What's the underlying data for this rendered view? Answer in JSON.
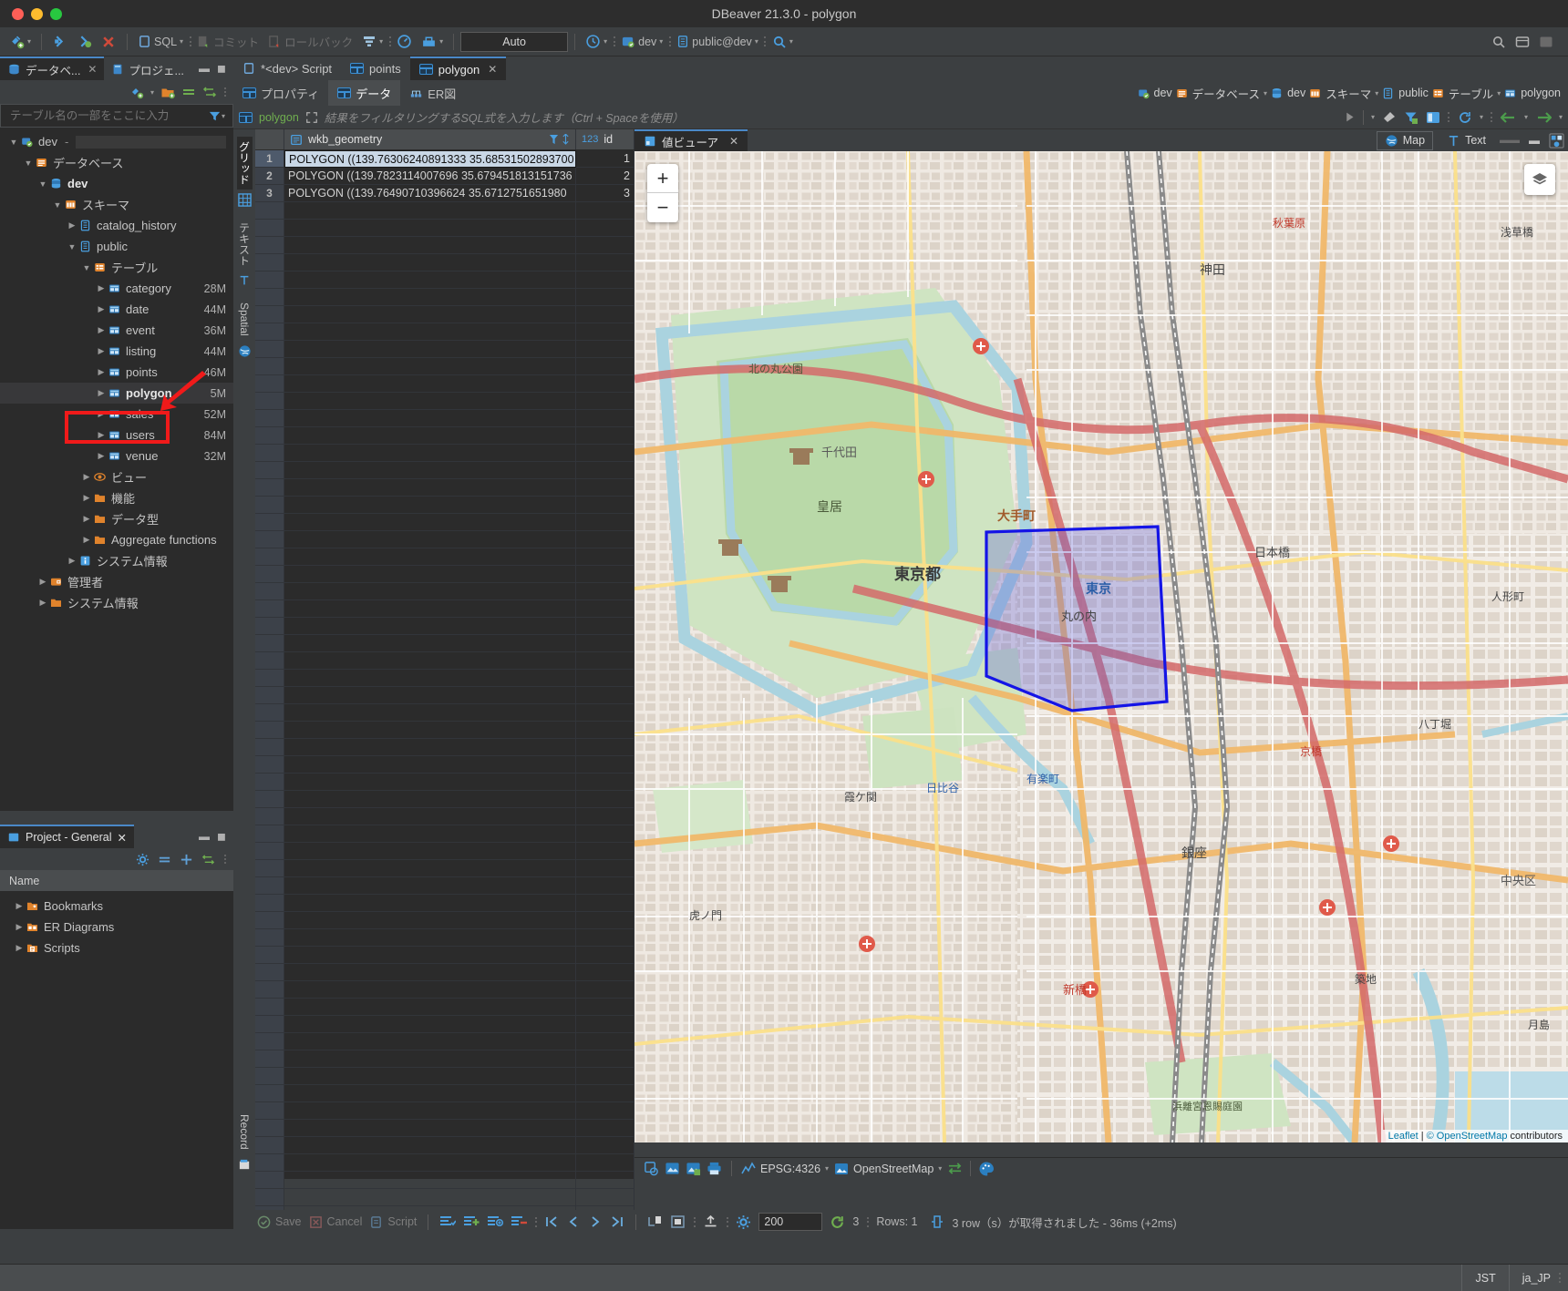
{
  "window": {
    "title": "DBeaver 21.3.0 - polygon"
  },
  "toolbar": {
    "items": [
      {
        "icon": "new-connection-icon",
        "label": ""
      },
      {
        "icon": "connect-icon",
        "label": ""
      },
      {
        "icon": "refresh-connection-icon",
        "label": ""
      },
      {
        "icon": "disconnect-icon",
        "label": ""
      },
      {
        "icon": "sql-editor-icon",
        "label": "SQL"
      },
      {
        "icon": "commit-icon",
        "label": "コミット"
      },
      {
        "icon": "rollback-icon",
        "label": "ロールバック"
      },
      {
        "icon": "transaction-mode-icon",
        "label": ""
      },
      {
        "icon": "dashboard-icon",
        "label": ""
      },
      {
        "icon": "db-tools-icon",
        "label": ""
      }
    ],
    "auto_commit_value": "Auto",
    "history_icon": "history-icon",
    "connection_label": "dev",
    "schema_label": "public@dev",
    "search_icon": "search-icon"
  },
  "left": {
    "tabs": [
      {
        "label": "データベ...",
        "active": true,
        "closable": true
      },
      {
        "label": "プロジェ...",
        "active": false,
        "closable": false
      }
    ],
    "minimize_icon": "minimize-icon",
    "maximize_icon": "maximize-icon",
    "filter_placeholder": "テーブル名の一部をここに入力",
    "filter_icon": "filter-icon",
    "tree": [
      {
        "indent": 0,
        "twist": "v",
        "icon": "connection-icon",
        "label": "dev",
        "suffix": "-",
        "size": "",
        "bold": false,
        "selected": false
      },
      {
        "indent": 1,
        "twist": "v",
        "icon": "database-folder-icon",
        "label": "データベース",
        "size": "",
        "bold": false,
        "selected": false
      },
      {
        "indent": 2,
        "twist": "v",
        "icon": "database-icon",
        "label": "dev",
        "size": "",
        "bold": true,
        "selected": false
      },
      {
        "indent": 3,
        "twist": "v",
        "icon": "schemas-icon",
        "label": "スキーマ",
        "size": "",
        "bold": false,
        "selected": false
      },
      {
        "indent": 4,
        "twist": ">",
        "icon": "schema-icon",
        "label": "catalog_history",
        "size": "",
        "bold": false,
        "selected": false
      },
      {
        "indent": 4,
        "twist": "v",
        "icon": "schema-icon",
        "label": "public",
        "size": "",
        "bold": false,
        "selected": false
      },
      {
        "indent": 5,
        "twist": "v",
        "icon": "tables-folder-icon",
        "label": "テーブル",
        "size": "",
        "bold": false,
        "selected": false
      },
      {
        "indent": 6,
        "twist": ">",
        "icon": "table-icon",
        "label": "category",
        "size": "28M",
        "bold": false,
        "selected": false
      },
      {
        "indent": 6,
        "twist": ">",
        "icon": "table-icon",
        "label": "date",
        "size": "44M",
        "bold": false,
        "selected": false
      },
      {
        "indent": 6,
        "twist": ">",
        "icon": "table-icon",
        "label": "event",
        "size": "36M",
        "bold": false,
        "selected": false
      },
      {
        "indent": 6,
        "twist": ">",
        "icon": "table-icon",
        "label": "listing",
        "size": "44M",
        "bold": false,
        "selected": false
      },
      {
        "indent": 6,
        "twist": ">",
        "icon": "table-icon",
        "label": "points",
        "size": "46M",
        "bold": false,
        "selected": false
      },
      {
        "indent": 6,
        "twist": ">",
        "icon": "table-icon",
        "label": "polygon",
        "size": "5M",
        "bold": true,
        "selected": true
      },
      {
        "indent": 6,
        "twist": ">",
        "icon": "table-icon",
        "label": "sales",
        "size": "52M",
        "bold": false,
        "selected": false
      },
      {
        "indent": 6,
        "twist": ">",
        "icon": "table-icon",
        "label": "users",
        "size": "84M",
        "bold": false,
        "selected": false
      },
      {
        "indent": 6,
        "twist": ">",
        "icon": "table-icon",
        "label": "venue",
        "size": "32M",
        "bold": false,
        "selected": false
      },
      {
        "indent": 5,
        "twist": ">",
        "icon": "views-icon",
        "label": "ビュー",
        "size": "",
        "bold": false,
        "selected": false
      },
      {
        "indent": 5,
        "twist": ">",
        "icon": "folder-icon",
        "label": "機能",
        "size": "",
        "bold": false,
        "selected": false
      },
      {
        "indent": 5,
        "twist": ">",
        "icon": "folder-icon",
        "label": "データ型",
        "size": "",
        "bold": false,
        "selected": false
      },
      {
        "indent": 5,
        "twist": ">",
        "icon": "folder-icon",
        "label": "Aggregate functions",
        "size": "",
        "bold": false,
        "selected": false
      },
      {
        "indent": 4,
        "twist": ">",
        "icon": "info-icon",
        "label": "システム情報",
        "size": "",
        "bold": false,
        "selected": false
      },
      {
        "indent": 2,
        "twist": ">",
        "icon": "admin-icon",
        "label": "管理者",
        "size": "",
        "bold": false,
        "selected": false
      },
      {
        "indent": 2,
        "twist": ">",
        "icon": "folder-icon",
        "label": "システム情報",
        "size": "",
        "bold": false,
        "selected": false
      }
    ]
  },
  "project": {
    "tab_label": "Project - General",
    "column_header": "Name",
    "items": [
      {
        "icon": "bookmarks-folder-icon",
        "label": "Bookmarks"
      },
      {
        "icon": "er-diagrams-folder-icon",
        "label": "ER Diagrams"
      },
      {
        "icon": "scripts-folder-icon",
        "label": "Scripts"
      }
    ]
  },
  "editor": {
    "tabs": [
      {
        "label": "*<dev> Script",
        "icon": "sql-script-icon",
        "active": false,
        "closable": false
      },
      {
        "label": "points",
        "icon": "table-icon",
        "active": false,
        "closable": false
      },
      {
        "label": "polygon",
        "icon": "table-icon",
        "active": true,
        "closable": true
      }
    ],
    "subtabs": [
      {
        "label": "プロパティ",
        "icon": "properties-icon",
        "active": false
      },
      {
        "label": "データ",
        "icon": "data-icon",
        "active": true
      },
      {
        "label": "ER図",
        "icon": "er-diagram-icon",
        "active": false
      }
    ],
    "breadcrumb": [
      {
        "label": "dev",
        "icon": "connection-icon",
        "caret": false
      },
      {
        "label": "データベース",
        "icon": "database-folder-icon",
        "caret": true
      },
      {
        "label": "dev",
        "icon": "database-icon",
        "caret": false
      },
      {
        "label": "スキーマ",
        "icon": "schemas-icon",
        "caret": true
      },
      {
        "label": "public",
        "icon": "schema-icon",
        "caret": false
      },
      {
        "label": "テーブル",
        "icon": "tables-folder-icon",
        "caret": true
      },
      {
        "label": "polygon",
        "icon": "table-icon",
        "caret": false
      }
    ],
    "filter": {
      "table_chip": "polygon",
      "placeholder": "結果をフィルタリングするSQL式を入力します（Ctrl + Spaceを使用）",
      "execute_icon": "execute-icon",
      "dropdown_icon": "chevron-down-icon",
      "clear_icon": "eraser-icon",
      "save_filter_icon": "filter-save-icon",
      "panels_icon": "panels-icon",
      "refresh_icon": "refresh-icon",
      "back_icon": "arrow-left-icon",
      "forward_icon": "arrow-right-icon"
    }
  },
  "grid": {
    "side_tabs": [
      {
        "label": "グリッド",
        "icon": "grid-icon",
        "active": true
      },
      {
        "label": "テキスト",
        "icon": "text-icon",
        "active": false
      },
      {
        "label": "Spatial",
        "icon": "spatial-icon",
        "active": false
      }
    ],
    "record_tab": {
      "label": "Record",
      "icon": "record-icon"
    },
    "columns": [
      {
        "name": "wkb_geometry",
        "icon": "geometry-column-icon",
        "type_badge": ""
      },
      {
        "name": "id",
        "icon": "",
        "type_badge": "123"
      }
    ],
    "rows": [
      {
        "num": "1",
        "wkb_geometry": "POLYGON ((139.76306240891333 35.68531502893700",
        "id": "1",
        "selected": true
      },
      {
        "num": "2",
        "wkb_geometry": "POLYGON ((139.7823114007696 35.679451813151736",
        "id": "2",
        "selected": false
      },
      {
        "num": "3",
        "wkb_geometry": "POLYGON ((139.76490710396624 35.6712751651980",
        "id": "3",
        "selected": false
      }
    ]
  },
  "value_viewer": {
    "tab_label": "値ビューア",
    "view_buttons": [
      {
        "label": "Map",
        "icon": "globe-icon",
        "active": true
      },
      {
        "label": "Text",
        "icon": "text-T-icon",
        "active": false
      }
    ],
    "minimize_icon": "minimize-icon",
    "panel_icon": "panel-layout-icon"
  },
  "map": {
    "zoom_in": "+",
    "zoom_out": "−",
    "layers_icon": "layers-icon",
    "attribution_leaflet": "Leaflet",
    "attribution_sep": " | ",
    "attribution_osm": "© OpenStreetMap",
    "attribution_tail": " contributors",
    "status": {
      "crs_label": "EPSG:4326",
      "crs_icon": "crs-icon",
      "tiles_label": "OpenStreetMap",
      "tiles_icon": "tiles-icon",
      "swap_icon": "swap-icon",
      "palette_icon": "palette-icon",
      "tool_icons": [
        "copy-image-icon",
        "show-image-icon",
        "save-image-icon",
        "print-icon"
      ]
    },
    "labels": [
      "東京都",
      "皇居",
      "千代田",
      "北の丸公園",
      "大手町",
      "東京",
      "日本橋",
      "銀座",
      "新橋",
      "有楽町",
      "日比谷",
      "霞ケ関",
      "虎ノ門",
      "八丁堀",
      "築地",
      "浜離宮恩賜庭園",
      "丸の内",
      "京橋",
      "神田",
      "秋葉原",
      "人形町",
      "中央区",
      "月島",
      "浅草橋"
    ]
  },
  "result_toolbar": {
    "save_label": "Save",
    "cancel_label": "Cancel",
    "script_label": "Script",
    "edit_icons": [
      "apply-changes-icon",
      "add-row-icon",
      "duplicate-row-icon",
      "delete-row-icon"
    ],
    "nav_icons": [
      "first-page-icon",
      "previous-page-icon",
      "next-page-icon",
      "last-page-icon"
    ],
    "fetch_icons": [
      "fetch-next-icon",
      "fetch-all-icon"
    ],
    "export_icon": "export-icon",
    "config_icon": "gear-icon",
    "fetch_size": "200",
    "refresh_icon": "refresh-icon",
    "refresh_count": "3",
    "rows_label": "Rows: 1",
    "status_icon": "status-icon",
    "status_text": "3 row（s）が取得されました - 36ms (+2ms)"
  },
  "statusbar": {
    "timezone": "JST",
    "locale": "ja_JP"
  }
}
